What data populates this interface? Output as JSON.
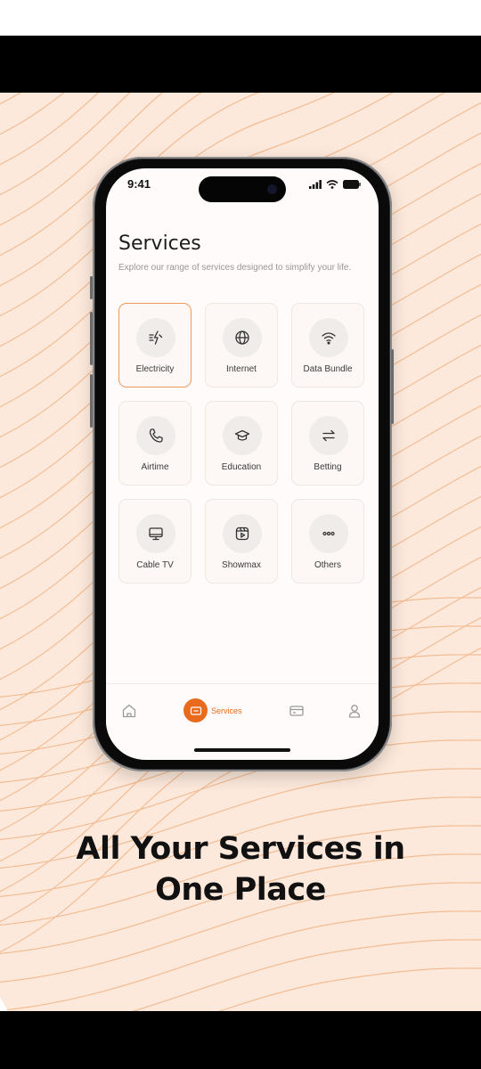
{
  "status_bar": {
    "time": "9:41"
  },
  "page": {
    "title": "Services",
    "subtitle": "Explore our range of services designed to simplify your life."
  },
  "services": [
    {
      "label": "Electricity",
      "icon": "electricity-icon",
      "selected": true
    },
    {
      "label": "Internet",
      "icon": "globe-icon",
      "selected": false
    },
    {
      "label": "Data Bundle",
      "icon": "wifi-icon",
      "selected": false
    },
    {
      "label": "Airtime",
      "icon": "phone-icon",
      "selected": false
    },
    {
      "label": "Education",
      "icon": "graduation-cap-icon",
      "selected": false
    },
    {
      "label": "Betting",
      "icon": "arrows-swap-icon",
      "selected": false
    },
    {
      "label": "Cable TV",
      "icon": "monitor-icon",
      "selected": false
    },
    {
      "label": "Showmax",
      "icon": "play-video-icon",
      "selected": false
    },
    {
      "label": "Others",
      "icon": "more-dots-icon",
      "selected": false
    }
  ],
  "tab_bar": {
    "active_tab": "Services",
    "tabs": [
      {
        "icon": "home-icon"
      },
      {
        "icon": "services-icon",
        "label": "Services"
      },
      {
        "icon": "card-icon"
      },
      {
        "icon": "profile-icon"
      }
    ]
  },
  "headline": {
    "line1": "All Your Services in",
    "line2": "One Place"
  },
  "colors": {
    "accent": "#e96a1c",
    "background": "#fce9db",
    "selected_border": "#f09a5f"
  }
}
